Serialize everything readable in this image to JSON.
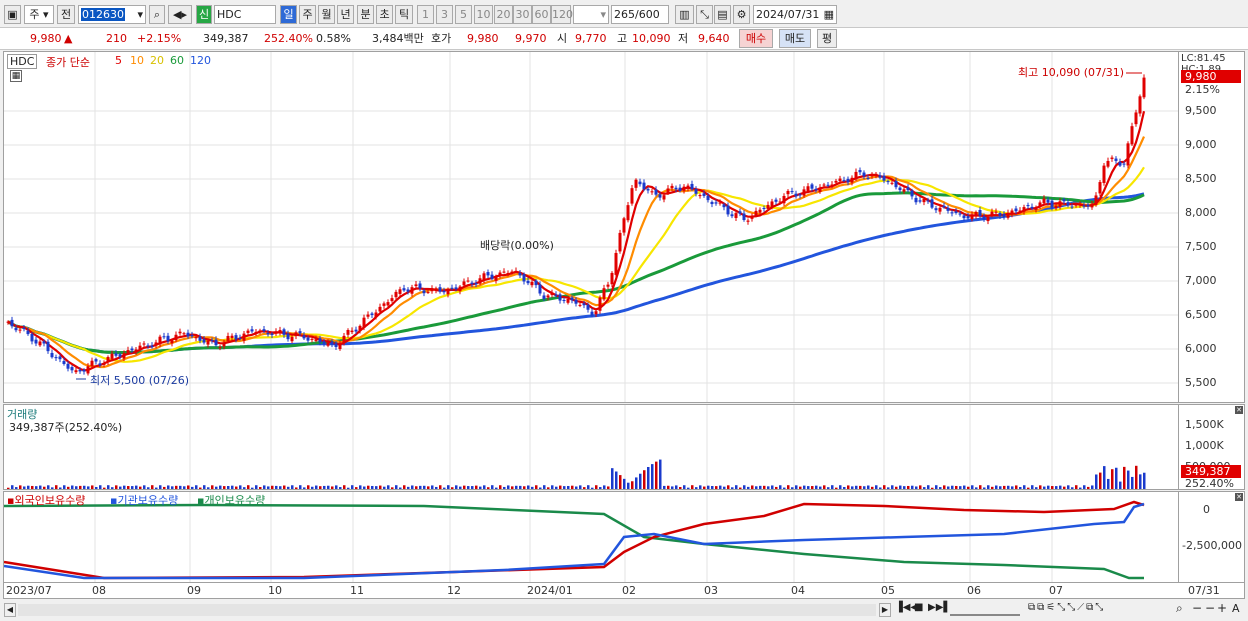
{
  "toolbar": {
    "type": "주",
    "prev": "전",
    "code": "012630",
    "market": "신",
    "name": "HDC",
    "periods": [
      "일",
      "주",
      "월",
      "년",
      "분",
      "초",
      "틱"
    ],
    "intervals": [
      "1",
      "3",
      "5",
      "10",
      "20",
      "30",
      "60",
      "120"
    ],
    "count": "265",
    "total": "/600",
    "date": "2024/07/31"
  },
  "info": {
    "price": "9,980",
    "arrow": "▲",
    "change": "210",
    "change_pct": "+2.15%",
    "volume": "349,387",
    "vol_ratio": "252.40%",
    "turnover": "0.58%",
    "amount": "3,484백만",
    "ask_label": "호가",
    "ask": "9,980",
    "bid": "9,970",
    "open_label": "시",
    "open": "9,770",
    "high_label": "고",
    "high": "10,090",
    "low_label": "저",
    "low": "9,640",
    "buy": "매수",
    "sell": "매도",
    "eval": "평"
  },
  "price_panel": {
    "name_tag": "HDC",
    "legend_label": "종가 단순",
    "ma": [
      "5",
      "10",
      "20",
      "60",
      "120"
    ],
    "ma_colors": [
      "#e00000",
      "#ff8c00",
      "#f7e600",
      "#1a9a3a",
      "#2255dd"
    ],
    "lc": "LC:81.45",
    "hc": "HC:1.89",
    "cur_tag": "9,980",
    "cur_pct": "2.15%",
    "y_ticks": [
      "9,500",
      "9,000",
      "8,500",
      "8,000",
      "7,500",
      "7,000",
      "6,500",
      "6,000",
      "5,500"
    ],
    "high_note": "최고 10,090 (07/31)",
    "low_note": "최저 5,500 (07/26)",
    "div_note": "배당락(0.00%)"
  },
  "volume_panel": {
    "title": "거래량",
    "info": "349,387주(252.40%)",
    "y_ticks": [
      "1,500K",
      "1,000K",
      "500,000"
    ],
    "tag": "349,387",
    "tag_pct": "252.40%"
  },
  "holding_panel": {
    "s1": "외국인보유수량",
    "s2": "기관보유수량",
    "s3": "개인보유수량",
    "y_ticks": [
      "0",
      "-2,500,000"
    ]
  },
  "x_axis": {
    "labels": [
      "2023/07",
      "08",
      "09",
      "10",
      "11",
      "12",
      "2024/01",
      "02",
      "03",
      "04",
      "05",
      "06",
      "07"
    ],
    "last": "07/31"
  }
}
